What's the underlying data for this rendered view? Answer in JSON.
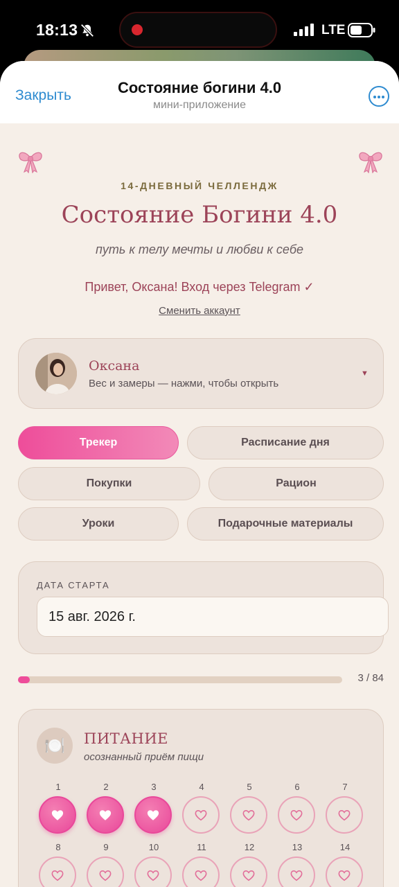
{
  "status_bar": {
    "time": "18:13",
    "network": "LTE"
  },
  "header": {
    "close": "Закрыть",
    "title": "Состояние богини 4.0",
    "subtitle": "мини-приложение"
  },
  "intro": {
    "kicker": "14-ДНЕВНЫЙ ЧЕЛЛЕНДЖ",
    "title": "Состояние Богини 4.0",
    "tagline": "путь к телу мечты и любви к себе",
    "greeting": "Привет, Оксана! Вход через Telegram ✓",
    "switch_account": "Сменить аккаунт"
  },
  "profile": {
    "name": "Оксана",
    "hint": "Вес и замеры — нажми, чтобы открыть",
    "caret": "▼"
  },
  "tabs": [
    {
      "label": "Трекер",
      "active": true
    },
    {
      "label": "Расписание дня",
      "active": false
    },
    {
      "label": "Покупки",
      "active": false
    },
    {
      "label": "Рацион",
      "active": false
    },
    {
      "label": "Уроки",
      "active": false
    },
    {
      "label": "Подарочные материалы",
      "active": false
    }
  ],
  "start_date": {
    "label": "ДАТА СТАРТА",
    "value": "15 авг. 2026 г."
  },
  "progress": {
    "text": "3 / 84",
    "done": 3,
    "total": 84
  },
  "nutrition": {
    "icon": "🍽️",
    "title": "ПИТАНИЕ",
    "subtitle": "осознанный приём пищи",
    "days": [
      {
        "n": "1",
        "done": true
      },
      {
        "n": "2",
        "done": true
      },
      {
        "n": "3",
        "done": true
      },
      {
        "n": "4",
        "done": false
      },
      {
        "n": "5",
        "done": false
      },
      {
        "n": "6",
        "done": false
      },
      {
        "n": "7",
        "done": false
      },
      {
        "n": "8",
        "done": false
      },
      {
        "n": "9",
        "done": false
      },
      {
        "n": "10",
        "done": false
      },
      {
        "n": "11",
        "done": false
      },
      {
        "n": "12",
        "done": false
      },
      {
        "n": "13",
        "done": false
      },
      {
        "n": "14",
        "done": false
      }
    ]
  },
  "colors": {
    "accent": "#ee4d9a",
    "title": "#9c4358",
    "link": "#2e8bd0"
  },
  "icons": [
    "bell-slash-icon",
    "signal-icon",
    "battery-icon",
    "more-icon",
    "bow-icon",
    "plate-icon",
    "heart-icon",
    "chevron-down-icon"
  ]
}
